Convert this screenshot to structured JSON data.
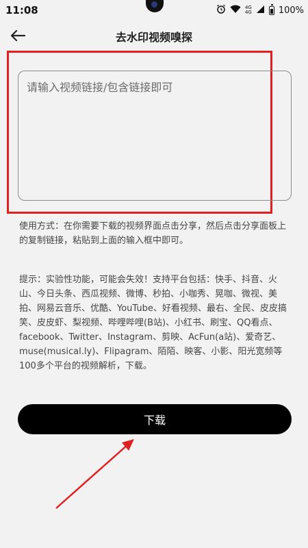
{
  "status_bar": {
    "time": "11:08",
    "network_top": "4G",
    "network_bottom": "4G",
    "battery": "100%",
    "icons": [
      "alarm-icon",
      "wifi-icon",
      "signal-icon",
      "battery-icon"
    ]
  },
  "header": {
    "back_icon": "arrow-left-icon",
    "title": "去水印视频嗅探"
  },
  "input": {
    "placeholder": "请输入视频链接/包含链接即可",
    "value": ""
  },
  "usage": "使用方式：在你需要下载的视频界面点击分享，然后点击分享面板上的复制链接，粘贴到上面的输入框中即可。",
  "tips": "提示：实验性功能，可能会失效！支持平台包括：快手、抖音、火山、今日头条、西瓜视频、微博、秒拍、小咖秀、晃咖、微视、美拍、网易云音乐、优酷、YouTube、好看视频、最右、全民、皮皮搞笑、皮皮虾、梨视频、哔哩哔哩(B站)、小红书、刷宝、QQ看点、facebook、Twitter、Instagram、剪映、AcFun(a站)、爱奇艺、muse(musical.ly)、Flipagram、陌陌、映客、小影、阳光宽频等100多个平台的视频解析，下载。",
  "download_button": "下载",
  "colors": {
    "background": "#f2f2f2",
    "button": "#000000",
    "button_text": "#ffffff",
    "annotation_red": "#e02020"
  }
}
